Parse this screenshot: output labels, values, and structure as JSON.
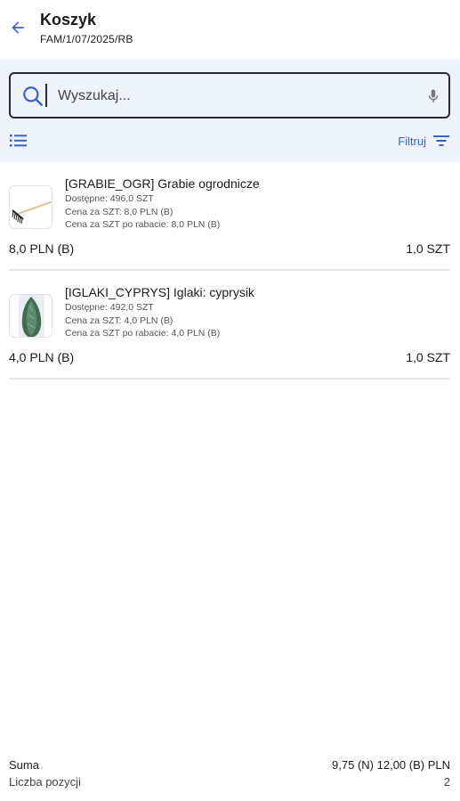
{
  "header": {
    "title": "Koszyk",
    "subtitle": "FAM/1/07/2025/RB",
    "back_icon": "arrow-left-icon"
  },
  "search": {
    "placeholder": "Wyszukaj...",
    "value": "",
    "icons": [
      "search-icon",
      "mic-icon"
    ]
  },
  "toolbar": {
    "view_icon": "list-icon",
    "filter_label": "Filtruj",
    "filter_icon": "filter-icon"
  },
  "colors": {
    "accent": "#3b63c4",
    "band_background": "#eef2f9"
  },
  "items": [
    {
      "name": "[GRABIE_OGR] Grabie ogrodnicze",
      "available": "Dostępne: 496,0 SZT",
      "unit_price": "Cena za SZT: 8,0 PLN (B)",
      "discount_price": "Cena za SZT po rabacie: 8,0 PLN (B)",
      "total": "8,0 PLN (B)",
      "quantity": "1,0 SZT",
      "thumbnail": "rake-image"
    },
    {
      "name": "[IGLAKI_CYPRYS] Iglaki: cyprysik",
      "available": "Dostępne: 492,0 SZT",
      "unit_price": "Cena za SZT: 4,0 PLN (B)",
      "discount_price": "Cena za SZT po rabacie: 4,0 PLN (B)",
      "total": "4,0 PLN (B)",
      "quantity": "1,0 SZT",
      "thumbnail": "cypress-image"
    }
  ],
  "footer": {
    "sum_label": "Suma",
    "sum_value": "9,75 (N) 12,00 (B) PLN",
    "count_label": "Liczba pozycji",
    "count_value": "2"
  }
}
